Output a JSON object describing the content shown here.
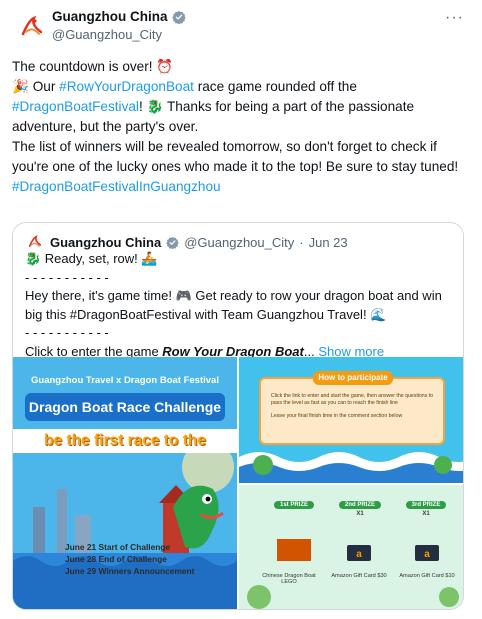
{
  "tweet": {
    "display_name": "Guangzhou China",
    "handle": "@Guangzhou_City",
    "more_icon": "more-dots-icon",
    "line1": "The countdown is over! ⏰",
    "line2_pre": "🎉 Our ",
    "line2_tag": "#RowYourDragonBoat",
    "line2_post": " race game rounded off the",
    "line3_tag": "#DragonBoatFestival",
    "line3_post": "! 🐉 Thanks for being a part of the passionate adventure, but the party's over.",
    "line4": "The list of winners will be revealed tomorrow, so don't forget to check if you're one of the lucky ones who made it to the top! Be sure to stay tuned!",
    "line5_tag": "#DragonBoatFestivalInGuangzhou"
  },
  "quote": {
    "display_name": "Guangzhou China",
    "handle": "@Guangzhou_City",
    "sep": " · ",
    "date": "Jun 23",
    "l1": "🐉 Ready, set, row! 🚣",
    "dash1": "- - - - - - - - - - -",
    "l2": "Hey there, it's game time! 🎮 Get ready to row your dragon boat and win big this #DragonBoatFestival with Team Guangzhou Travel! 🌊",
    "dash2": "- - - - - - - - - - -",
    "l3_pre": "Click to enter the game ",
    "l3_em": "Row Your Dragon Boat",
    "l3_ellipsis": "...",
    "show_more": "Show more"
  },
  "media": {
    "left_top": "Guangzhou Travel x Dragon Boat Festival",
    "left_banner": "Dragon Boat Race Challenge",
    "left_strip": "be the first race to the",
    "sched1": "June 21  Start of Challenge",
    "sched2": "June 28  End of Challenge",
    "sched3": "June 29  Winners Announcement",
    "how_title": "How to participate",
    "how1": "Click the link to enter and start the game, then answer the questions to pass the level as fast as you can to reach the finish line",
    "how2": "Leave your final finish time in the comment section below",
    "prize1_tag": "1st PRIZE",
    "prize2_tag": "2nd PRIZE",
    "prize3_tag": "3rd PRIZE",
    "prize2_count": "X1",
    "prize3_count": "X1",
    "prize1_name": "Chinese Dragon Boat LEGO",
    "prize2_name": "Amazon Gift Card $30",
    "prize3_name": "Amazon Gift Card $10"
  },
  "colors": {
    "link": "#1d9bf0",
    "muted": "#536471",
    "border": "#cfd9de"
  }
}
